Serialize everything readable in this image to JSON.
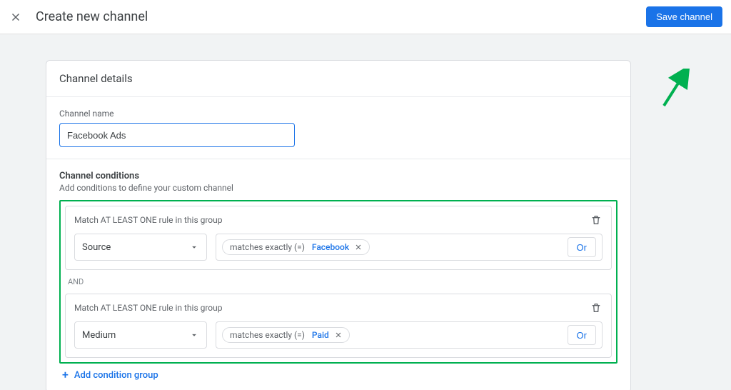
{
  "header": {
    "title": "Create new channel",
    "save_label": "Save channel"
  },
  "details": {
    "section_title": "Channel details",
    "name_label": "Channel name",
    "name_value": "Facebook Ads"
  },
  "conditions": {
    "section_title": "Channel conditions",
    "section_subtitle": "Add conditions to define your custom channel",
    "group_title": "Match AT LEAST ONE rule in this group",
    "and_label": "AND",
    "or_label": "Or",
    "add_group_label": "Add condition group",
    "groups": [
      {
        "dimension": "Source",
        "operator": "matches exactly (=)",
        "value": "Facebook"
      },
      {
        "dimension": "Medium",
        "operator": "matches exactly (=)",
        "value": "Paid"
      }
    ]
  }
}
